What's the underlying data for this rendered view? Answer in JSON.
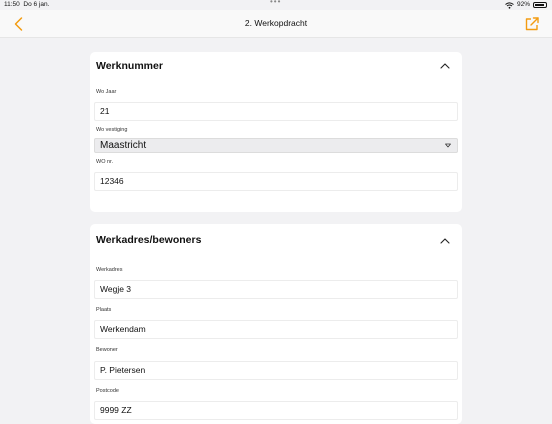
{
  "status": {
    "time": "11:50",
    "date": "Do 6 jan.",
    "battery": "92%"
  },
  "nav": {
    "title": "2. Werkopdracht",
    "accent": "#f39c12"
  },
  "werknummer": {
    "title": "Werknummer",
    "wo_jaar_label": "Wo Jaar",
    "wo_jaar_value": "21",
    "wo_vestiging_label": "Wo vestiging",
    "wo_vestiging_value": "Maastricht",
    "wo_nr_label": "WO nr.",
    "wo_nr_value": "12346"
  },
  "werkadres": {
    "title": "Werkadres/bewoners",
    "werkadres_label": "Werkadres",
    "werkadres_value": "Wegje 3",
    "plaats_label": "Plaats",
    "plaats_value": "Werkendam",
    "bewoner_label": "Bewoner",
    "bewoner_value": "P. Pietersen",
    "postcode_label": "Postcode",
    "postcode_value": "9999 ZZ"
  },
  "icons": [
    "wifi-icon",
    "battery-icon",
    "back-chevron-icon",
    "share-icon",
    "chevron-up-icon",
    "dropdown-caret-icon"
  ]
}
